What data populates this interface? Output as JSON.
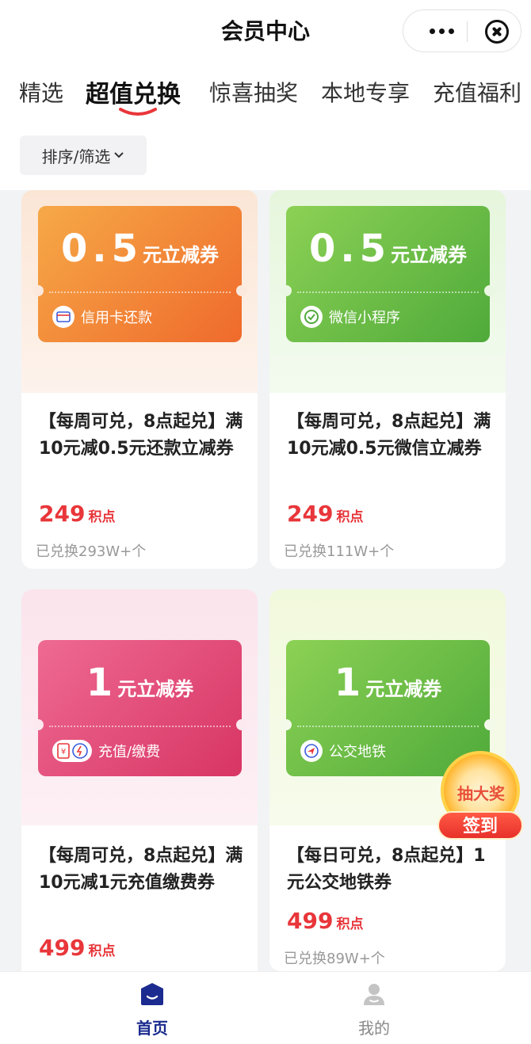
{
  "header": {
    "title": "会员中心",
    "tabs": [
      "精选",
      "超值兑换",
      "惊喜抽奖",
      "本地专享",
      "充值福利"
    ],
    "active_tab": "超值兑换",
    "filter_label": "排序/筛选"
  },
  "cards": [
    {
      "value": "0.5",
      "unit": "元立减券",
      "tag": "信用卡还款",
      "tag_icon": "credit-card-icon",
      "name": "【每周可兑，8点起兑】满10元减0.5元还款立减券",
      "points": "249",
      "points_label": "积点",
      "sold": "已兑换293W+个"
    },
    {
      "value": "0.5",
      "unit": "元立减券",
      "tag": "微信小程序",
      "tag_icon": "wechat-miniprogram-icon",
      "name": "【每周可兑，8点起兑】满10元减0.5元微信立减券",
      "points": "249",
      "points_label": "积点",
      "sold": "已兑换111W+个"
    },
    {
      "value": "1",
      "unit": "元立减券",
      "tag": "充值/缴费",
      "tag_icon": "recharge-icon",
      "name": "【每周可兑，8点起兑】满10元减1元充值缴费券",
      "points": "499",
      "points_label": "积点",
      "sold": ""
    },
    {
      "value": "1",
      "unit": "元立减券",
      "tag": "公交地铁",
      "tag_icon": "navigation-icon",
      "name": "【每日可兑，8点起兑】1元公交地铁券",
      "points": "499",
      "points_label": "积点",
      "sold": "已兑换89W+个"
    }
  ],
  "lottery": {
    "title": "抽大奖",
    "button": "签到"
  },
  "bottom_nav": [
    {
      "label": "首页",
      "icon": "home-icon",
      "active": true
    },
    {
      "label": "我的",
      "icon": "profile-icon",
      "active": false
    }
  ],
  "colors": {
    "accent_red": "#e8363a",
    "nav_active": "#1b2b8f",
    "orange": "#f0782e",
    "green": "#6cc04a",
    "pink": "#e04a72"
  }
}
